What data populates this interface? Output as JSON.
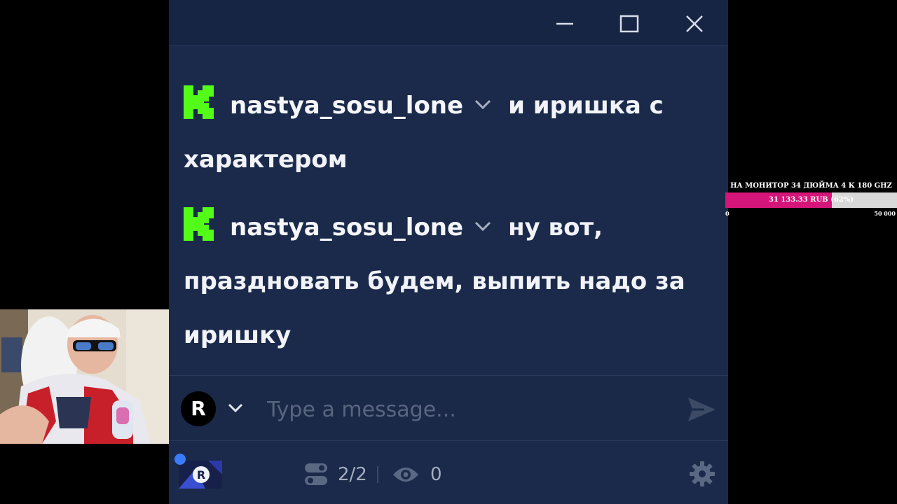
{
  "chat": {
    "messages": [
      {
        "platform_icon": "kick-logo-icon",
        "username": "nastya_sosu_lone",
        "line1": "и иришка с",
        "line2": "характером"
      },
      {
        "platform_icon": "kick-logo-icon",
        "username": "nastya_sosu_lone",
        "line1": "ну вот,",
        "line2": "праздновать будем, выпить надо за",
        "line3": "иришку"
      }
    ],
    "composer": {
      "avatar_letter": "R",
      "placeholder": "Type a message..."
    },
    "footer": {
      "connections": "2/2",
      "viewers": "0"
    }
  },
  "goal": {
    "title": "НА МОНИТОР 34 ДЮЙМА 4 К 180 GHZ",
    "amount_text": "31 133.33 RUB (62%)",
    "progress_fraction": 0.62,
    "min_label": "0",
    "max_label": "50 000"
  },
  "colors": {
    "chat_bg": "#1b2a4a",
    "kick_green": "#53fc18",
    "goal_fill": "#d4157a"
  }
}
